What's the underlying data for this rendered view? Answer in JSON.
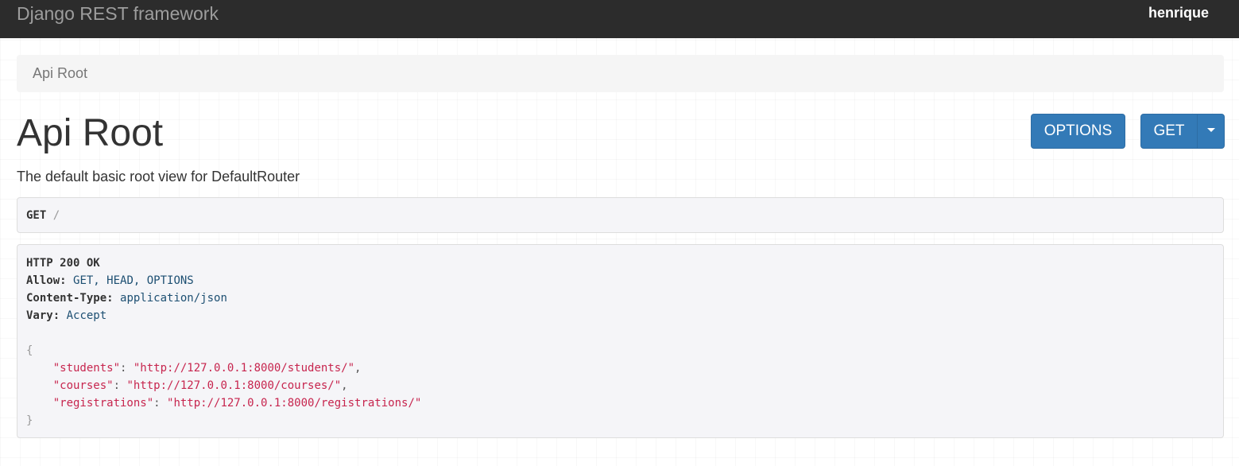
{
  "navbar": {
    "brand": "Django REST framework",
    "user": "henrique"
  },
  "breadcrumb": {
    "label": "Api Root"
  },
  "page": {
    "title": "Api Root",
    "description": "The default basic root view for DefaultRouter"
  },
  "buttons": {
    "options_label": "OPTIONS",
    "get_label": "GET"
  },
  "request": {
    "method": "GET",
    "path": "/"
  },
  "response": {
    "status": "HTTP 200 OK",
    "headers": [
      {
        "name": "Allow:",
        "value": "GET, HEAD, OPTIONS"
      },
      {
        "name": "Content-Type:",
        "value": "application/json"
      },
      {
        "name": "Vary:",
        "value": "Accept"
      }
    ],
    "open_brace": "{",
    "close_brace": "}",
    "body": [
      {
        "key": "\"students\"",
        "value": "\"http://127.0.0.1:8000/students/\"",
        "suffix": ","
      },
      {
        "key": "\"courses\"",
        "value": "\"http://127.0.0.1:8000/courses/\"",
        "suffix": ","
      },
      {
        "key": "\"registrations\"",
        "value": "\"http://127.0.0.1:8000/registrations/\"",
        "suffix": ""
      }
    ]
  },
  "colors": {
    "navbar_bg": "#2c2c2c",
    "primary_button": "#337ab7",
    "json_string": "#c7254e",
    "header_value": "#1d4f72"
  }
}
